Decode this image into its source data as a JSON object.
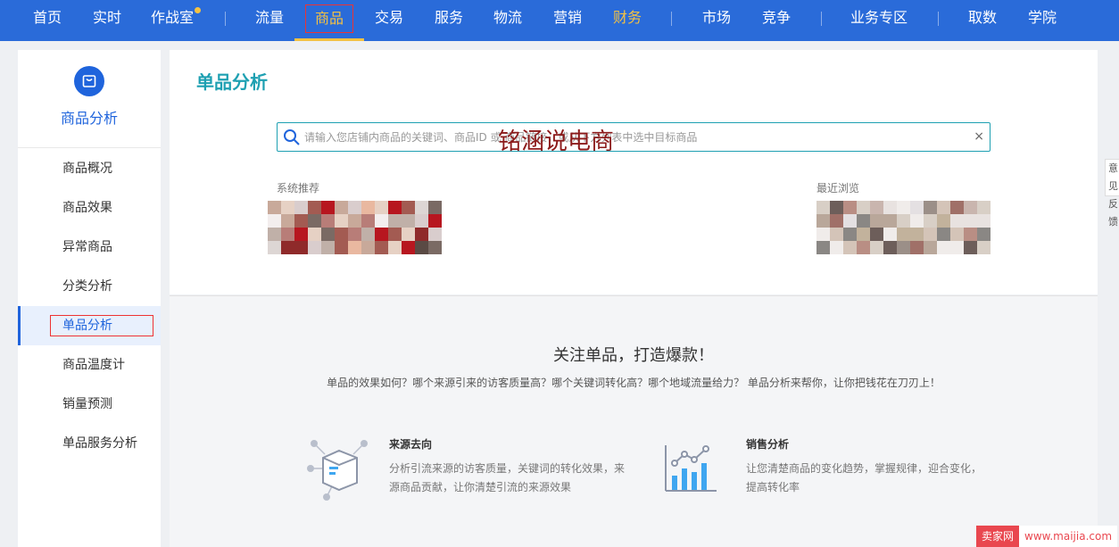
{
  "nav": {
    "items": [
      "首页",
      "实时",
      "作战室",
      "流量",
      "商品",
      "交易",
      "服务",
      "物流",
      "营销",
      "财务",
      "市场",
      "竞争",
      "业务专区",
      "取数",
      "学院"
    ],
    "active_index": 4,
    "highlight_index": 9,
    "dot_index": 2
  },
  "sidebar": {
    "logo_icon": "shopping-bag-icon",
    "title": "商品分析",
    "items": [
      "商品概况",
      "商品效果",
      "异常商品",
      "分类分析",
      "单品分析",
      "商品温度计",
      "销量预测",
      "单品服务分析"
    ],
    "active_index": 4
  },
  "main": {
    "page_title": "单品分析",
    "search": {
      "icon": "search-icon",
      "placeholder": "请输入您店铺内商品的关键词、商品ID 或 商品链接，或从下方列表中选中目标商品",
      "clear_icon": "×"
    },
    "watermark": "铭涵说电商",
    "system_recommend_label": "系统推荐",
    "recent_browse_label": "最近浏览"
  },
  "promo": {
    "title": "关注单品，打造爆款！",
    "subtitle": "单品的效果如何？哪个来源引来的访客质量高？哪个关键词转化高？哪个地域流量给力？ 单品分析来帮你，让你把钱花在刀刃上！",
    "features": [
      {
        "icon": "source-box-icon",
        "title": "来源去向",
        "desc": "分析引流来源的访客质量，关键词的转化效果，来源商品贡献，让你清楚引流的来源效果"
      },
      {
        "icon": "sales-chart-icon",
        "title": "销售分析",
        "desc": "让您清楚商品的变化趋势，掌握规律，迎合变化，提高转化率"
      }
    ]
  },
  "feedback_tab": "意见反馈",
  "corner_watermark": {
    "badge": "卖家网",
    "url": "www.maijia.com"
  },
  "colors": {
    "nav_bg": "#2a6bd9",
    "accent": "#1f64dc",
    "teal": "#1ea0b2",
    "gold": "#f5c242"
  }
}
